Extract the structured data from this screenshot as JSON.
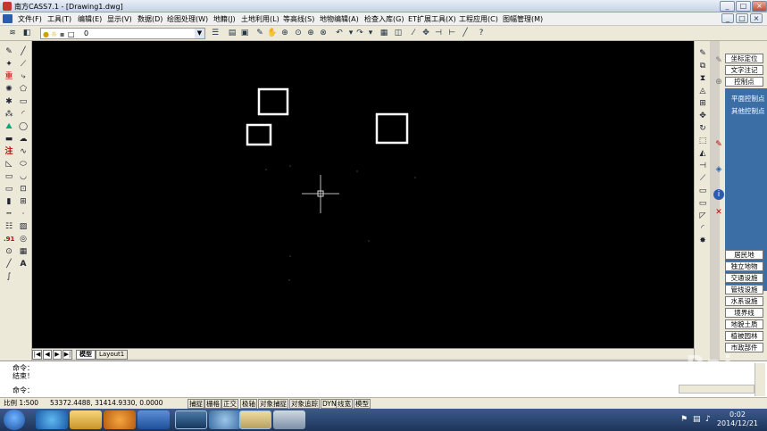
{
  "window": {
    "title": "南方CASS7.1 - [Drawing1.dwg]",
    "controls": [
      "_",
      "□",
      "×"
    ],
    "inner_controls": [
      "_",
      "□",
      "×"
    ]
  },
  "menu": {
    "items": [
      "文件(F)",
      "工具(T)",
      "编辑(E)",
      "显示(V)",
      "数据(D)",
      "绘图处理(W)",
      "地籍(J)",
      "土地利用(L)",
      "等高线(S)",
      "地物编辑(A)",
      "检查入库(G)",
      "ET扩展工具(X)",
      "工程应用(C)",
      "图幅管理(M)"
    ]
  },
  "toolbar": {
    "layer_value": "0"
  },
  "left_tools": {
    "text_tool": "A",
    "label_zhu": "注",
    "label_91": ".91"
  },
  "drawing": {
    "crosshair": true
  },
  "layout_tabs": {
    "nav": [
      "|◀",
      "◀",
      "▶",
      "▶|"
    ],
    "tabs": [
      "模型",
      "Layout1"
    ]
  },
  "panel": {
    "top_buttons": [
      "坐标定位",
      "文字注记",
      "控制点"
    ],
    "blue_items": [
      "平面控制点",
      "其他控制点"
    ],
    "bottom_buttons": [
      "居民地",
      "独立地物",
      "交通设施",
      "管线设施",
      "水系设施",
      "境界线",
      "地貌土质",
      "植被园林",
      "市政部件"
    ]
  },
  "command": {
    "lines": [
      "命令：",
      "结束！",
      "命令："
    ]
  },
  "status": {
    "scale": "比例  1:500",
    "coords": "53372.4488,  31414.9330,  0.0000",
    "toggles": [
      "捕捉",
      "栅格",
      "正交",
      "极轴",
      "对象捕捉",
      "对象追踪",
      "DYN",
      "线宽",
      "模型"
    ]
  },
  "taskbar": {
    "time": "0:02",
    "date": "2014/12/21",
    "apps": [
      "ie-icon",
      "folder-icon",
      "media-player-icon",
      "word-icon",
      "cass-icon",
      "paint-icon",
      "photo-viewer-icon",
      "calculator-icon"
    ]
  },
  "watermark": "Bai"
}
